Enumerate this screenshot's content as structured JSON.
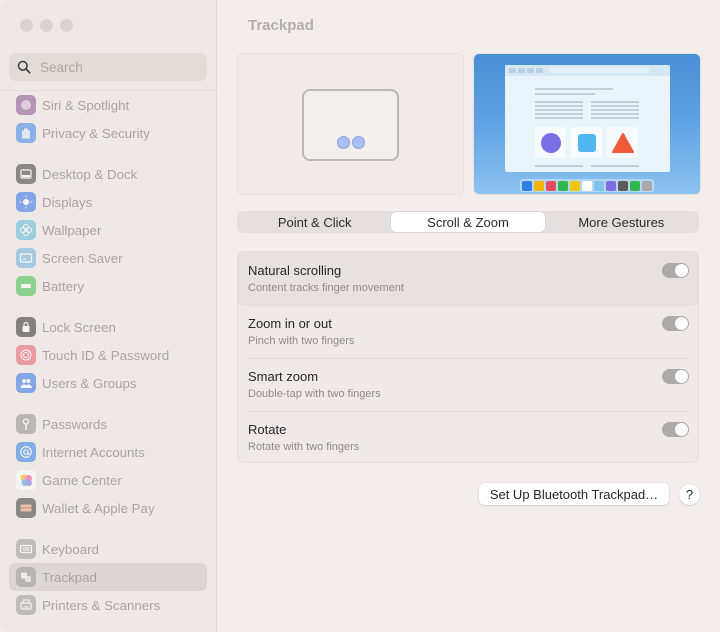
{
  "window": {
    "title": "Trackpad",
    "traffic_lights": [
      "close",
      "minimize",
      "zoom"
    ]
  },
  "search": {
    "placeholder": "Search",
    "value": ""
  },
  "sidebar": {
    "groups": [
      [
        {
          "label": "Siri & Spotlight",
          "icon": "siri-icon",
          "color": "#8a4f8f"
        },
        {
          "label": "Privacy & Security",
          "icon": "hand-icon",
          "color": "#3b82e8"
        }
      ],
      [
        {
          "label": "Desktop & Dock",
          "icon": "dock-icon",
          "color": "#3a3a3a"
        },
        {
          "label": "Displays",
          "icon": "sun-icon",
          "color": "#2f6fe6"
        },
        {
          "label": "Wallpaper",
          "icon": "flower-icon",
          "color": "#5ab8d8"
        },
        {
          "label": "Screen Saver",
          "icon": "screen-saver-icon",
          "color": "#6ab2e0"
        },
        {
          "label": "Battery",
          "icon": "battery-icon",
          "color": "#3fbf4c"
        }
      ],
      [
        {
          "label": "Lock Screen",
          "icon": "lock-icon",
          "color": "#2c2c2c"
        },
        {
          "label": "Touch ID & Password",
          "icon": "fingerprint-icon",
          "color": "#e85a6a"
        },
        {
          "label": "Users & Groups",
          "icon": "users-icon",
          "color": "#2f6fe6"
        }
      ],
      [
        {
          "label": "Passwords",
          "icon": "key-icon",
          "color": "#8e8e8e"
        },
        {
          "label": "Internet Accounts",
          "icon": "at-icon",
          "color": "#2f7de6"
        },
        {
          "label": "Game Center",
          "icon": "game-center-icon",
          "color": "#e46fb0"
        },
        {
          "label": "Wallet & Apple Pay",
          "icon": "wallet-icon",
          "color": "#3a3a3a"
        }
      ],
      [
        {
          "label": "Keyboard",
          "icon": "keyboard-icon",
          "color": "#9a9a9a"
        },
        {
          "label": "Trackpad",
          "icon": "trackpad-icon",
          "color": "#9a9a9a",
          "selected": true
        },
        {
          "label": "Printers & Scanners",
          "icon": "printer-icon",
          "color": "#9a9a9a"
        }
      ]
    ]
  },
  "preview": {
    "dock_colors": [
      "#2f7de6",
      "#f5b400",
      "#e84a5f",
      "#2fb84a",
      "#f2c500",
      "#ffffff",
      "#7cc4ec",
      "#7f6ee0",
      "#5a5a5a",
      "#2fb84a",
      "#a8a8a8"
    ]
  },
  "tabs": [
    {
      "label": "Point & Click",
      "active": false
    },
    {
      "label": "Scroll & Zoom",
      "active": true
    },
    {
      "label": "More Gestures",
      "active": false
    }
  ],
  "settings": [
    {
      "title": "Natural scrolling",
      "subtitle": "Content tracks finger movement",
      "enabled": true,
      "highlighted": true
    },
    {
      "title": "Zoom in or out",
      "subtitle": "Pinch with two fingers",
      "enabled": true
    },
    {
      "title": "Smart zoom",
      "subtitle": "Double-tap with two fingers",
      "enabled": true
    },
    {
      "title": "Rotate",
      "subtitle": "Rotate with two fingers",
      "enabled": true
    }
  ],
  "buttons": {
    "bluetooth_setup": "Set Up Bluetooth Trackpad…",
    "help": "?"
  }
}
